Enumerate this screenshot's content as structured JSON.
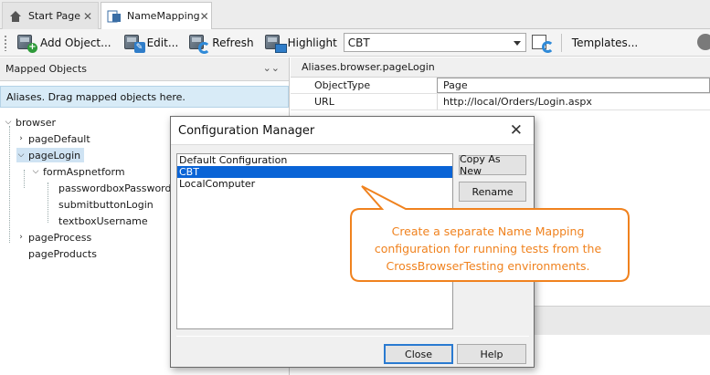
{
  "tabs": [
    {
      "label": "Start Page",
      "icon": "home-icon",
      "active": false
    },
    {
      "label": "NameMapping",
      "icon": "namemapping-icon",
      "active": true
    }
  ],
  "toolbar": {
    "add_object_label": "Add Object...",
    "edit_label": "Edit...",
    "refresh_label": "Refresh",
    "highlight_label": "Highlight",
    "configuration_value": "CBT",
    "templates_label": "Templates..."
  },
  "left_panel": {
    "title": "Mapped Objects",
    "hint": "Aliases. Drag mapped objects here.",
    "tree": [
      {
        "label": "browser",
        "level": 0,
        "expander": "expanded"
      },
      {
        "label": "pageDefault",
        "level": 1,
        "expander": "collapsed"
      },
      {
        "label": "pageLogin",
        "level": 1,
        "expander": "expanded",
        "selected": true
      },
      {
        "label": "formAspnetform",
        "level": 2,
        "expander": "expanded"
      },
      {
        "label": "passwordboxPassword",
        "level": 3,
        "expander": "none"
      },
      {
        "label": "submitbuttonLogin",
        "level": 3,
        "expander": "none"
      },
      {
        "label": "textboxUsername",
        "level": 3,
        "expander": "none"
      },
      {
        "label": "pageProcess",
        "level": 1,
        "expander": "collapsed"
      },
      {
        "label": "pageProducts",
        "level": 1,
        "expander": "none"
      }
    ]
  },
  "right_panel": {
    "path": "Aliases.browser.pageLogin",
    "properties": [
      {
        "name": "ObjectType",
        "value": "Page"
      },
      {
        "name": "URL",
        "value": "http://local/Orders/Login.aspx"
      }
    ]
  },
  "dialog": {
    "title": "Configuration Manager",
    "configurations": [
      {
        "label": "Default Configuration",
        "selected": false
      },
      {
        "label": "CBT",
        "selected": true
      },
      {
        "label": "LocalComputer",
        "selected": false
      }
    ],
    "copy_as_new_label": "Copy As New",
    "rename_label": "Rename",
    "close_label": "Close",
    "help_label": "Help"
  },
  "callout": {
    "lines": [
      "Create a separate Name Mapping",
      "configuration for running tests from the",
      "CrossBrowserTesting environments."
    ],
    "color": "#f0821e"
  },
  "colors": {
    "selection_blue": "#0a64d6",
    "tree_selection": "#cfe3f3",
    "hint_background": "#d8ebf7"
  }
}
